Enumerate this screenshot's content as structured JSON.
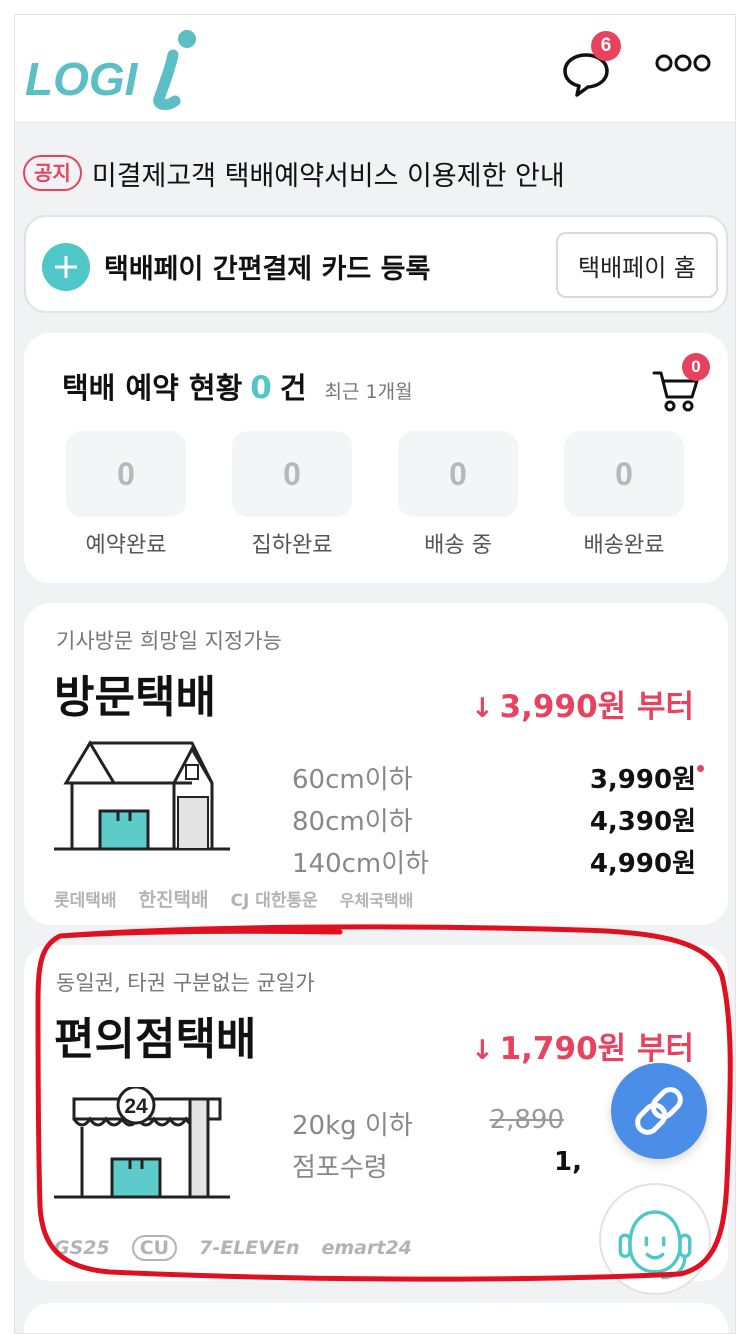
{
  "header": {
    "logo_text": "LOGI",
    "chat_badge": "6",
    "icons": {
      "chat": "chat-bubble-icon",
      "more": "more-dots-icon"
    }
  },
  "notice": {
    "tag": "공지",
    "text": "미결제고객 택배예약서비스 이용제한 안내"
  },
  "paybar": {
    "text": "택배페이 간편결제 카드 등록",
    "home_button": "택배페이 홈"
  },
  "status": {
    "title": "택배 예약 현황",
    "count": "0",
    "count_unit": "건",
    "period": "최근 1개월",
    "cart_badge": "0",
    "items": [
      {
        "value": "0",
        "label": "예약완료"
      },
      {
        "value": "0",
        "label": "집하완료"
      },
      {
        "value": "0",
        "label": "배송 중"
      },
      {
        "value": "0",
        "label": "배송완료"
      }
    ]
  },
  "visit": {
    "subtitle": "기사방문 희망일 지정가능",
    "title": "방문택배",
    "from_arrow": "↓",
    "from_price": "3,990원 부터",
    "rows": [
      {
        "label": "60cm이하",
        "price": "3,990원"
      },
      {
        "label": "80cm이하",
        "price": "4,390원"
      },
      {
        "label": "140cm이하",
        "price": "4,990원"
      }
    ],
    "carriers": [
      "롯데택배",
      "한진택배",
      "CJ 대한통운",
      "우체국택배"
    ]
  },
  "convenience": {
    "subtitle": "동일권, 타권 구분없는 균일가",
    "title": "편의점택배",
    "from_arrow": "↓",
    "from_price": "1,790원 부터",
    "store_number": "24",
    "rows": [
      {
        "label": "20kg 이하",
        "price": "2,890"
      },
      {
        "label": "점포수령",
        "price": "1,"
      }
    ],
    "stores": [
      "GS25",
      "CU",
      "7-ELEVEn",
      "emart24"
    ]
  },
  "colors": {
    "accent_teal": "#4fc7c9",
    "accent_red": "#e8425f",
    "fab_blue": "#4a8ee8",
    "annotation": "#e01020"
  }
}
